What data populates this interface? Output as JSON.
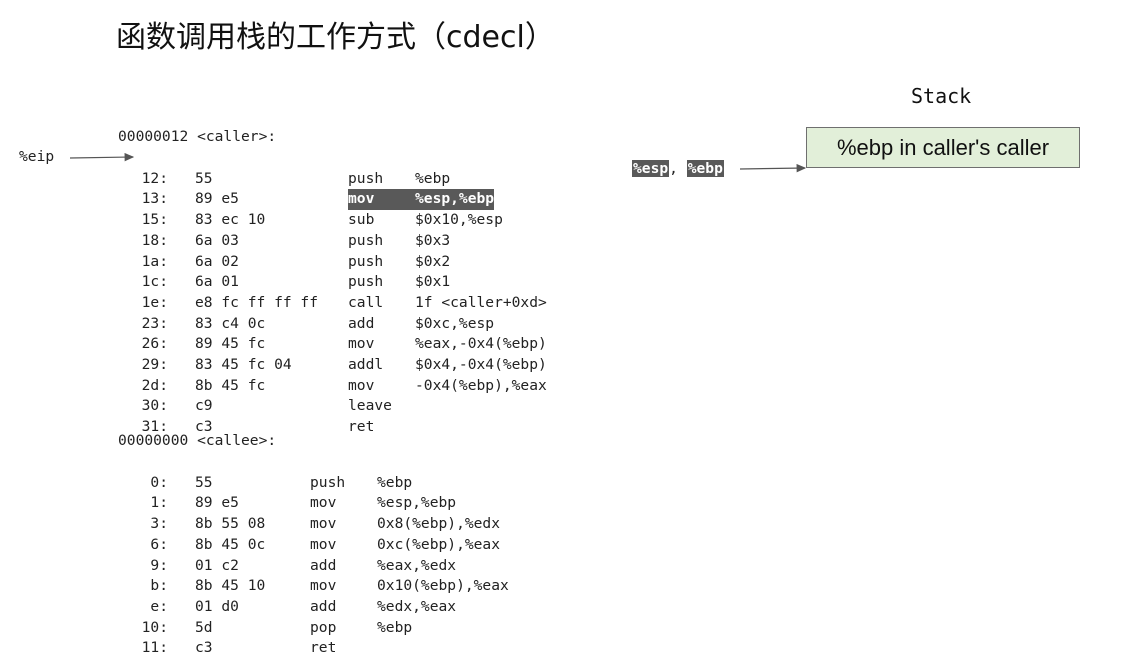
{
  "title": "函数调用栈的工作方式（cdecl）",
  "caller": {
    "header": "00000012 <caller>:",
    "rows": [
      {
        "addr": "12:",
        "bytes": "55",
        "mnemonic": "push",
        "operands": "%ebp",
        "highlight": false
      },
      {
        "addr": "13:",
        "bytes": "89 e5",
        "mnemonic": "mov",
        "operands": "%esp,%ebp",
        "highlight": true
      },
      {
        "addr": "15:",
        "bytes": "83 ec 10",
        "mnemonic": "sub",
        "operands": "$0x10,%esp",
        "highlight": false
      },
      {
        "addr": "18:",
        "bytes": "6a 03",
        "mnemonic": "push",
        "operands": "$0x3",
        "highlight": false
      },
      {
        "addr": "1a:",
        "bytes": "6a 02",
        "mnemonic": "push",
        "operands": "$0x2",
        "highlight": false
      },
      {
        "addr": "1c:",
        "bytes": "6a 01",
        "mnemonic": "push",
        "operands": "$0x1",
        "highlight": false
      },
      {
        "addr": "1e:",
        "bytes": "e8 fc ff ff ff",
        "mnemonic": "call",
        "operands": "1f <caller+0xd>",
        "highlight": false
      },
      {
        "addr": "23:",
        "bytes": "83 c4 0c",
        "mnemonic": "add",
        "operands": "$0xc,%esp",
        "highlight": false
      },
      {
        "addr": "26:",
        "bytes": "89 45 fc",
        "mnemonic": "mov",
        "operands": "%eax,-0x4(%ebp)",
        "highlight": false
      },
      {
        "addr": "29:",
        "bytes": "83 45 fc 04",
        "mnemonic": "addl",
        "operands": "$0x4,-0x4(%ebp)",
        "highlight": false
      },
      {
        "addr": "2d:",
        "bytes": "8b 45 fc",
        "mnemonic": "mov",
        "operands": "-0x4(%ebp),%eax",
        "highlight": false
      },
      {
        "addr": "30:",
        "bytes": "c9",
        "mnemonic": "leave",
        "operands": "",
        "highlight": false
      },
      {
        "addr": "31:",
        "bytes": "c3",
        "mnemonic": "ret",
        "operands": "",
        "highlight": false
      }
    ]
  },
  "callee": {
    "header": "00000000 <callee>:",
    "rows": [
      {
        "addr": "0:",
        "bytes": "55",
        "mnemonic": "push",
        "operands": "%ebp"
      },
      {
        "addr": "1:",
        "bytes": "89 e5",
        "mnemonic": "mov",
        "operands": "%esp,%ebp"
      },
      {
        "addr": "3:",
        "bytes": "8b 55 08",
        "mnemonic": "mov",
        "operands": "0x8(%ebp),%edx"
      },
      {
        "addr": "6:",
        "bytes": "8b 45 0c",
        "mnemonic": "mov",
        "operands": "0xc(%ebp),%eax"
      },
      {
        "addr": "9:",
        "bytes": "01 c2",
        "mnemonic": "add",
        "operands": "%eax,%edx"
      },
      {
        "addr": "b:",
        "bytes": "8b 45 10",
        "mnemonic": "mov",
        "operands": "0x10(%ebp),%eax"
      },
      {
        "addr": "e:",
        "bytes": "01 d0",
        "mnemonic": "add",
        "operands": "%edx,%eax"
      },
      {
        "addr": "10:",
        "bytes": "5d",
        "mnemonic": "pop",
        "operands": "%ebp"
      },
      {
        "addr": "11:",
        "bytes": "c3",
        "mnemonic": "ret",
        "operands": ""
      }
    ]
  },
  "eip": {
    "label": "%eip",
    "points_to_caller_row": 2
  },
  "stack": {
    "title": "Stack",
    "cells": [
      "%ebp in caller's caller"
    ],
    "cell_color": "#e2efd9",
    "pointer_regs": [
      "%esp",
      "%ebp"
    ],
    "pointer_separator": ", "
  },
  "colors": {
    "highlight_bg": "#595959",
    "highlight_fg": "#ffffff",
    "arrow": "#555555"
  }
}
